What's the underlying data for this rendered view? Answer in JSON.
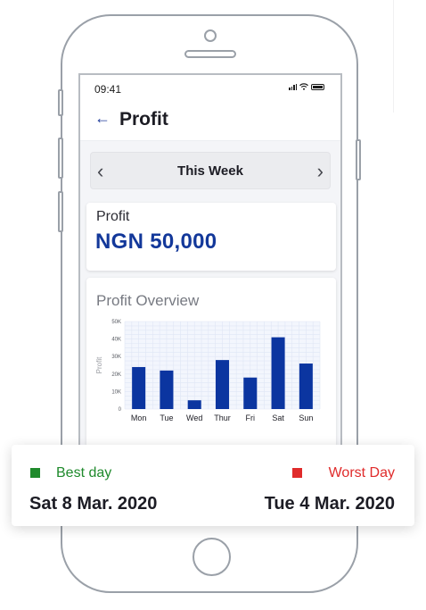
{
  "status_bar": {
    "time": "09:41"
  },
  "header": {
    "back_icon": "arrow-left-icon",
    "title": "Profit"
  },
  "week_selector": {
    "label": "This Week",
    "prev_icon": "chevron-left-icon",
    "next_icon": "chevron-right-icon"
  },
  "profit_card": {
    "label": "Profit",
    "amount": "NGN 50,000"
  },
  "overview": {
    "title": "Profit Overview",
    "chart_data": {
      "type": "bar",
      "categories": [
        "Mon",
        "Tue",
        "Wed",
        "Thur",
        "Fri",
        "Sat",
        "Sun"
      ],
      "values": [
        24000,
        22000,
        5000,
        28000,
        18000,
        41000,
        26000
      ],
      "ylabel": "Profit",
      "ylim": [
        0,
        50000
      ],
      "yticks": [
        "0",
        "10K",
        "20K",
        "30K",
        "40K",
        "50K"
      ],
      "grid": true,
      "bar_color": "#0b35a0"
    }
  },
  "summary": {
    "best_label": "Best day",
    "best_date": "Sat 8 Mar. 2020",
    "best_color": "#1f8a2c",
    "worst_label": "Worst Day",
    "worst_date": "Tue 4 Mar. 2020",
    "worst_color": "#e02b2b"
  }
}
